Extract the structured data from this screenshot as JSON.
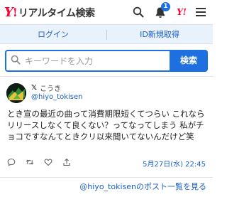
{
  "header": {
    "logo_text": "リアルタイム検索",
    "notification_count": "1",
    "yj_label": "Y!",
    "icons": [
      "search-icon",
      "bell-icon",
      "yahoo-japan-icon",
      "menu-icon"
    ]
  },
  "login_bar": {
    "login_label": "ログイン",
    "register_label": "ID新規取得"
  },
  "search": {
    "placeholder": "キーワードを入力",
    "button_label": "検索"
  },
  "tweet": {
    "source_mark": "𝕏",
    "user_name": "こうき",
    "user_handle": "@hiyo_tokisen",
    "body": "とき宣の最近の曲って消費期限短くてつらい これならリリースしなくて良くない？ってなってしまう 私がチョコですなんてときクリ以来聞いてないんだけど笑",
    "timestamp": "5月27日(水) 22:45",
    "actions": [
      "reply-icon",
      "retweet-icon",
      "like-icon",
      "share-icon"
    ]
  },
  "more_link": "@hiyo_tokisenのポスト一覧を見る",
  "colors": {
    "brand_red": "#ff0033",
    "accent_blue": "#1e6fe0",
    "link_blue": "#1a5fc9",
    "login_bar_bg": "#e9f1fb"
  }
}
